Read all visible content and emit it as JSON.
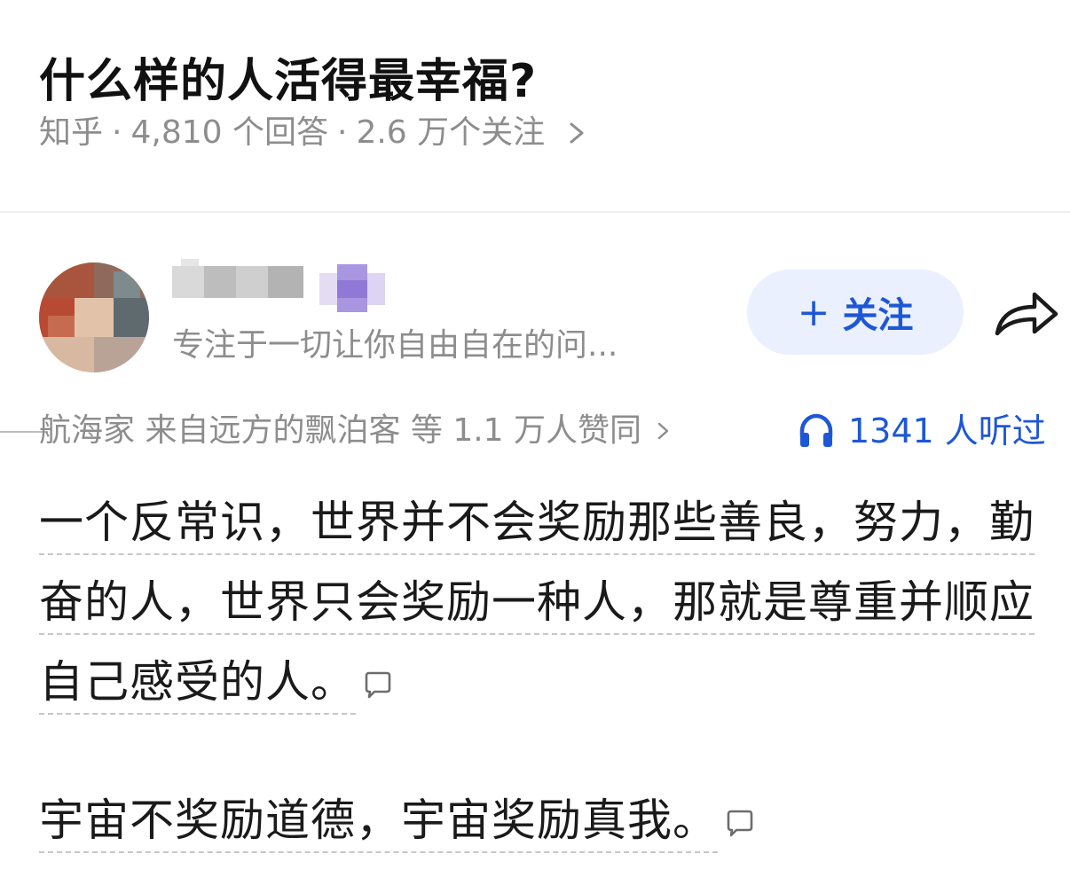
{
  "question": {
    "title": "什么样的人活得最幸福?",
    "source": "知乎",
    "answers": "4,810 个回答",
    "followers": "2.6 万个关注",
    "separator": "·"
  },
  "author": {
    "bio": "专注于一切让你自由自在的问...",
    "follow_label": "关注"
  },
  "answer": {
    "voters": "航海家 来自远方的飘泊客 等 1.1 万人赞同",
    "listen_count": "1341 人听过",
    "paragraphs": [
      "一个反常识，世界并不会奖励那些善良，努力，勤奋的人，世界只会奖励一种人，那就是尊重并顺应自己感受的人。",
      "宇宙不奖励道德，宇宙奖励真我。"
    ]
  },
  "colors": {
    "accent": "#1e57d6",
    "follow_bg": "#eaf0fd",
    "meta_text": "#8d8d8d",
    "title_text": "#111111"
  },
  "icons": [
    "chevron-right-icon",
    "share-icon",
    "headphone-icon",
    "comment-icon",
    "plus-icon"
  ]
}
